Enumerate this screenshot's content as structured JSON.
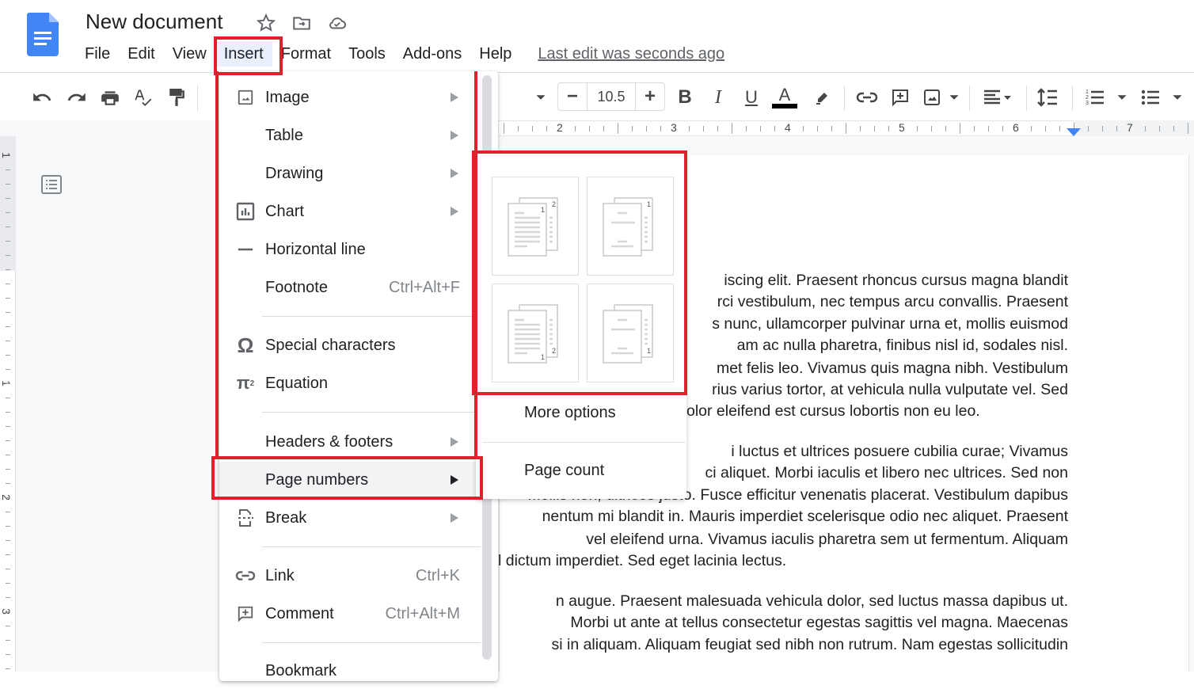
{
  "app": {
    "title": "New document",
    "last_edit": "Last edit was seconds ago",
    "icons": [
      "docs-logo-icon",
      "star-icon",
      "move-to-folder-icon",
      "cloud-saved-icon"
    ]
  },
  "menubar": {
    "items": [
      "File",
      "Edit",
      "View",
      "Insert",
      "Format",
      "Tools",
      "Add-ons",
      "Help"
    ],
    "active": "Insert"
  },
  "toolbar": {
    "font_size": "10.5",
    "decrease_label": "−",
    "increase_label": "+",
    "text_color": "#000000",
    "icons": [
      "undo-icon",
      "redo-icon",
      "print-icon",
      "spellcheck-icon",
      "paint-format-icon",
      "font-dropdown-icon",
      "bold-icon",
      "italic-icon",
      "underline-icon",
      "text-color-icon",
      "highlight-icon",
      "link-icon",
      "add-comment-icon",
      "insert-image-icon",
      "align-icon",
      "line-spacing-icon",
      "numbered-list-icon",
      "bulleted-list-icon"
    ]
  },
  "ruler": {
    "horizontal_numbers": [
      "2",
      "3",
      "4",
      "5",
      "6",
      "7"
    ],
    "vertical_numbers": [
      "1",
      "1",
      "2",
      "3"
    ],
    "indent_marker_color": "#4285f4"
  },
  "insert_menu": {
    "items": [
      {
        "label": "Image",
        "icon": "image-icon",
        "submenu": true
      },
      {
        "label": "Table",
        "icon": "",
        "submenu": true
      },
      {
        "label": "Drawing",
        "icon": "",
        "submenu": true
      },
      {
        "label": "Chart",
        "icon": "chart-icon",
        "submenu": true
      },
      {
        "label": "Horizontal line",
        "icon": "horizontal-line-icon",
        "submenu": false
      },
      {
        "label": "Footnote",
        "icon": "",
        "shortcut": "Ctrl+Alt+F"
      },
      {
        "label": "Special characters",
        "icon": "omega-icon",
        "submenu": false
      },
      {
        "label": "Equation",
        "icon": "pi-squared-icon",
        "submenu": false
      },
      {
        "label": "Headers & footers",
        "icon": "",
        "submenu": true
      },
      {
        "label": "Page numbers",
        "icon": "",
        "submenu": true,
        "highlighted": true
      },
      {
        "label": "Break",
        "icon": "page-break-icon",
        "submenu": true
      },
      {
        "label": "Link",
        "icon": "link-icon",
        "shortcut": "Ctrl+K"
      },
      {
        "label": "Comment",
        "icon": "add-comment-icon",
        "shortcut": "Ctrl+Alt+M"
      },
      {
        "label": "Bookmark",
        "icon": ""
      }
    ]
  },
  "page_numbers_submenu": {
    "options": [
      {
        "name": "top-right-all-pages",
        "numbers": [
          "1",
          "2"
        ]
      },
      {
        "name": "top-right-skip-first",
        "numbers": [
          "1"
        ]
      },
      {
        "name": "bottom-right-all-pages",
        "numbers": [
          "1",
          "2"
        ]
      },
      {
        "name": "bottom-right-skip-first",
        "numbers": [
          "1"
        ]
      }
    ],
    "more_options": "More options",
    "page_count": "Page count"
  },
  "document": {
    "lines": [
      "iscing elit. Praesent rhoncus cursus magna blandit",
      "rci vestibulum, nec tempus arcu convallis. Praesent",
      "s nunc, ullamcorper pulvinar urna et, mollis euismod",
      "am ac nulla pharetra, finibus nisl id, sodales nisl.",
      "met felis leo. Vivamus quis magna nibh. Vestibulum",
      "rius varius tortor, at vehicula nulla vulputate vel. Sed",
      "olor eleifend est cursus lobortis non eu leo.",
      "i luctus et ultrices posuere cubilia curae; Vivamus",
      "ci aliquet. Morbi iaculis et libero nec ultrices. Sed non",
      "Mollis non, ultrices justo. Fusce efficitur venenatis placerat. Vestibulum dapibus",
      "nentum mi blandit in. Mauris imperdiet scelerisque odio nec aliquet. Praesent",
      "vel eleifend urna. Vivamus iaculis pharetra sem ut fermentum. Aliquam",
      "l dictum imperdiet. Sed eget lacinia lectus.",
      "n augue. Praesent malesuada vehicula dolor, sed luctus massa dapibus ut.",
      "Morbi ut ante at tellus consectetur egestas sagittis vel magna. Maecenas",
      "si in aliquam. Aliquam feugiat sed nibh non rutrum. Nam egestas sollicitudin"
    ]
  },
  "colors": {
    "highlight_box": "#e0202c",
    "docs_blue": "#4285f4",
    "menu_hover": "#f1f3f4"
  }
}
